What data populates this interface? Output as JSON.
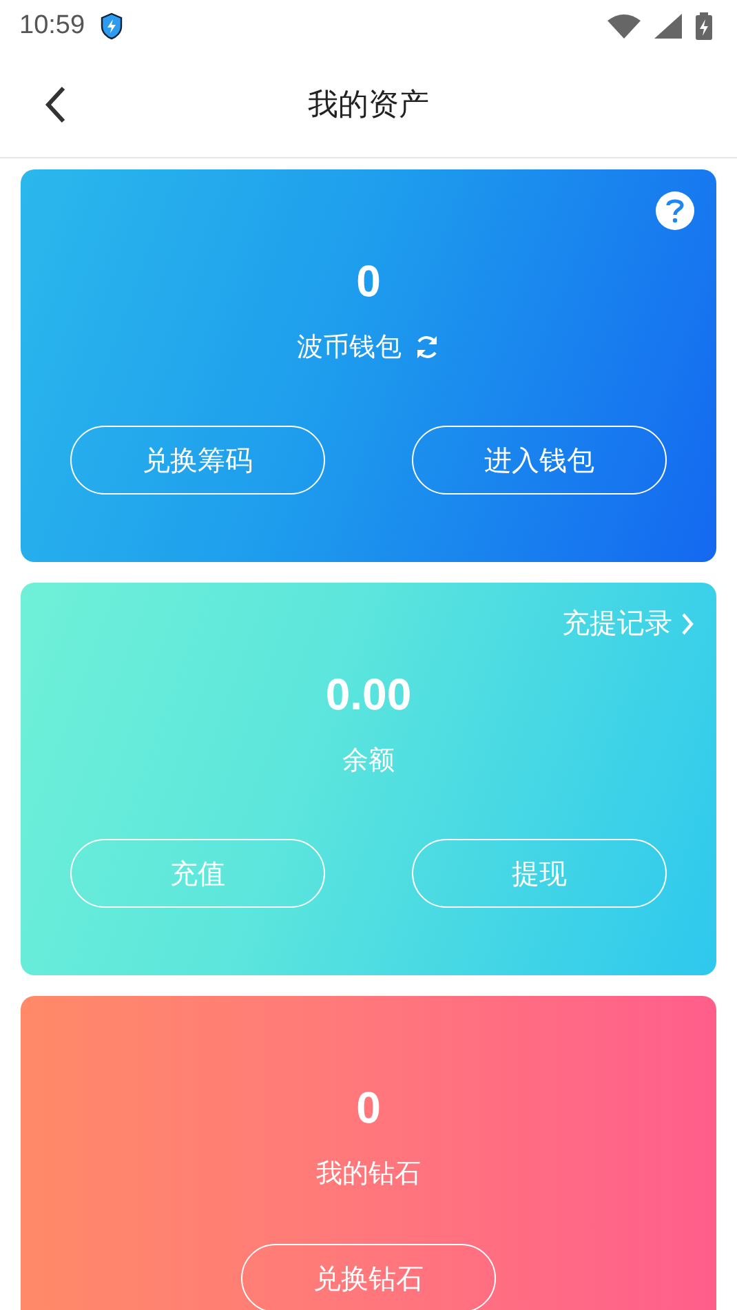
{
  "status_bar": {
    "time": "10:59"
  },
  "header": {
    "title": "我的资产"
  },
  "cards": [
    {
      "kind": "wallet",
      "amount": "0",
      "label": "波币钱包",
      "buttons": [
        "兑换筹码",
        "进入钱包"
      ]
    },
    {
      "kind": "balance",
      "amount": "0.00",
      "label": "余额",
      "link": "充提记录",
      "buttons": [
        "充值",
        "提现"
      ]
    },
    {
      "kind": "diamond",
      "amount": "0",
      "label": "我的钻石",
      "buttons": [
        "兑换钻石"
      ]
    }
  ]
}
